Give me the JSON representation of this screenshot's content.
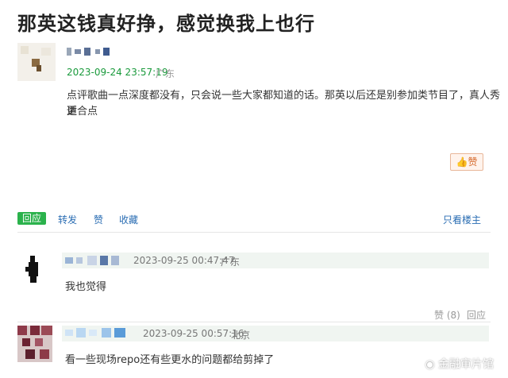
{
  "title": "那英这钱真好挣，感觉换我上也行",
  "post": {
    "timestamp": "2023-09-24 23:57:19",
    "location": "广东",
    "content_line1": "点评歌曲一点深度都没有，只会说一些大家都知道的话。那英以后还是别参加类节目了，真人秀更",
    "content_line2": "适合点",
    "like_label": "赞"
  },
  "actions": {
    "reply": "回应",
    "forward": "转发",
    "like": "赞",
    "collect": "收藏",
    "op_only": "只看楼主"
  },
  "replies": [
    {
      "timestamp": "2023-09-25 00:47:47",
      "location": "广东",
      "content": "我也觉得",
      "like_count": "赞 (8)",
      "reply_label": "回应"
    },
    {
      "timestamp": "2023-09-25 00:57:16",
      "location": "北京",
      "content": "看一些现场repo还有些更水的问题都给剪掉了"
    }
  ],
  "watermark": "金融审片馆"
}
